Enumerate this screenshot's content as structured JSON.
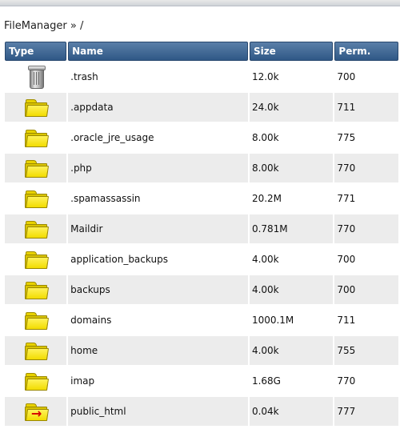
{
  "breadcrumb": "FileManager » /",
  "columns": {
    "type": "Type",
    "name": "Name",
    "size": "Size",
    "perm": "Perm."
  },
  "rows": [
    {
      "icon": "trash-icon",
      "name": ".trash",
      "size": "12.0k",
      "perm": "700"
    },
    {
      "icon": "folder-icon",
      "name": ".appdata",
      "size": "24.0k",
      "perm": "711"
    },
    {
      "icon": "folder-icon",
      "name": ".oracle_jre_usage",
      "size": "8.00k",
      "perm": "775"
    },
    {
      "icon": "folder-icon",
      "name": ".php",
      "size": "8.00k",
      "perm": "770"
    },
    {
      "icon": "folder-icon",
      "name": ".spamassassin",
      "size": "20.2M",
      "perm": "771"
    },
    {
      "icon": "folder-icon",
      "name": "Maildir",
      "size": "0.781M",
      "perm": "770"
    },
    {
      "icon": "folder-icon",
      "name": "application_backups",
      "size": "4.00k",
      "perm": "700"
    },
    {
      "icon": "folder-icon",
      "name": "backups",
      "size": "4.00k",
      "perm": "700"
    },
    {
      "icon": "folder-icon",
      "name": "domains",
      "size": "1000.1M",
      "perm": "711"
    },
    {
      "icon": "folder-icon",
      "name": "home",
      "size": "4.00k",
      "perm": "755"
    },
    {
      "icon": "folder-icon",
      "name": "imap",
      "size": "1.68G",
      "perm": "770"
    },
    {
      "icon": "folder-link-icon",
      "name": "public_html",
      "size": "0.04k",
      "perm": "777"
    }
  ],
  "colors": {
    "header": "#2f5886",
    "row_alt": "#ececec",
    "folder": "#f2dc00",
    "link_arrow": "#d40000"
  }
}
